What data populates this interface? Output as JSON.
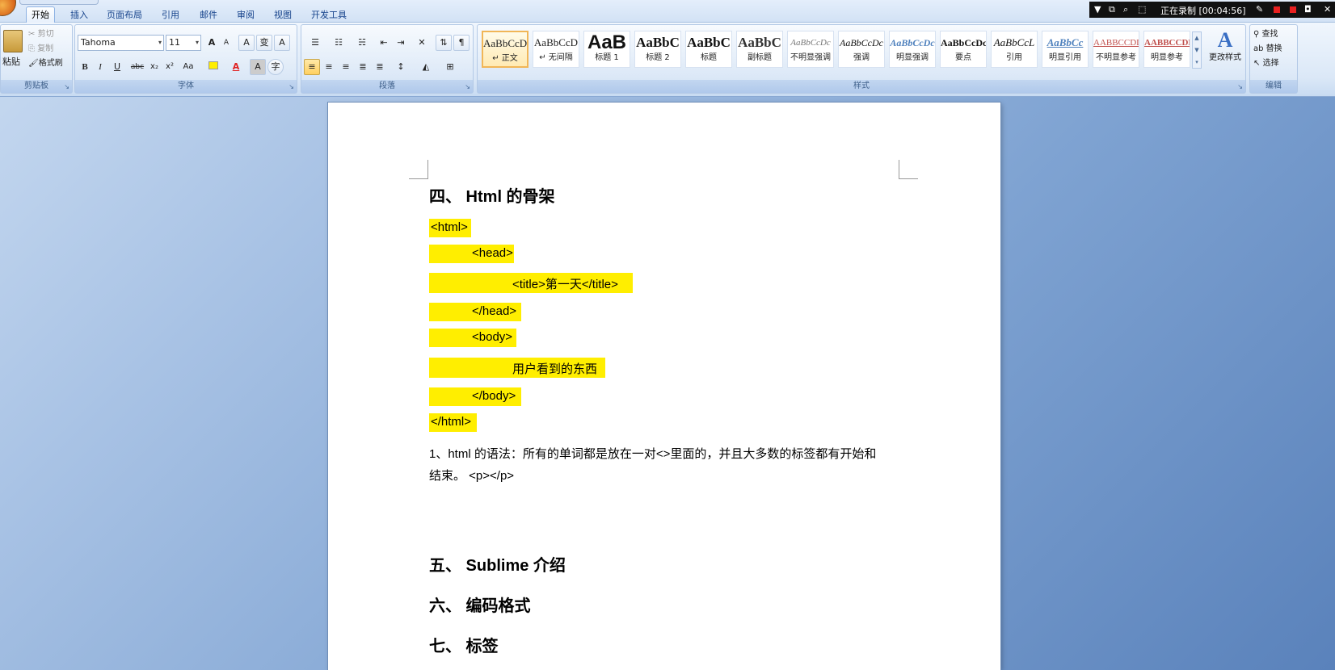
{
  "ribbon_tabs": [
    "开始",
    "插入",
    "页面布局",
    "引用",
    "邮件",
    "审阅",
    "视图",
    "开发工具"
  ],
  "recorder": {
    "status": "正在录制 [00:04:56]"
  },
  "clipboard": {
    "paste": "粘贴",
    "cut": "剪切",
    "copy": "复制",
    "format_painter": "格式刷",
    "label": "剪贴板"
  },
  "font": {
    "name": "Tahoma",
    "size": "11",
    "label": "字体",
    "bold": "B",
    "italic": "I",
    "underline": "U",
    "strike": "abc",
    "subscript": "x₂",
    "superscript": "x²",
    "change_case": "Aa",
    "grow": "A",
    "shrink": "A",
    "clear": "A",
    "phonetic": "变",
    "border": "A",
    "shade": "A",
    "enclose": "字"
  },
  "paragraph": {
    "label": "段落"
  },
  "styles": {
    "label": "样式",
    "items": [
      {
        "preview": "AaBbCcD",
        "name": "↵ 正文"
      },
      {
        "preview": "AaBbCcD",
        "name": "↵ 无间隔"
      },
      {
        "preview": "AaB",
        "name": "标题 1"
      },
      {
        "preview": "AaBbC",
        "name": "标题 2"
      },
      {
        "preview": "AaBbC",
        "name": "标题"
      },
      {
        "preview": "AaBbC",
        "name": "副标题"
      },
      {
        "preview": "AaBbCcDc",
        "name": "不明显强调"
      },
      {
        "preview": "AaBbCcDc",
        "name": "强调"
      },
      {
        "preview": "AaBbCcDc",
        "name": "明显强调"
      },
      {
        "preview": "AaBbCcDc",
        "name": "要点"
      },
      {
        "preview": "AaBbCcL",
        "name": "引用"
      },
      {
        "preview": "AaBbCc",
        "name": "明显引用"
      },
      {
        "preview": "AABBCCDD",
        "name": "不明显参考"
      },
      {
        "preview": "AABBCCDD",
        "name": "明显参考"
      }
    ],
    "change": "更改样式"
  },
  "editing": {
    "find": "查找",
    "replace": "替换",
    "select": "选择",
    "label": "编辑"
  },
  "doc": {
    "h4": "四、  Html 的骨架",
    "code": [
      "<html>",
      "<head>",
      "<title>第一天</title>",
      "</head>",
      "<body>",
      "用户看到的东西",
      "</body>",
      "</html>"
    ],
    "p1a": "1、html 的语法：所有的单词都是放在一对<>里面的，并且大多数的标签都有开始和",
    "p1b": "结束。 <p></p>",
    "h5": "五、  Sublime 介绍",
    "h6": "六、  编码格式",
    "h7": "七、  标签"
  },
  "colors": {
    "highlight": "#ffee00",
    "font_color": "#e02020",
    "accent": "#15428b"
  }
}
